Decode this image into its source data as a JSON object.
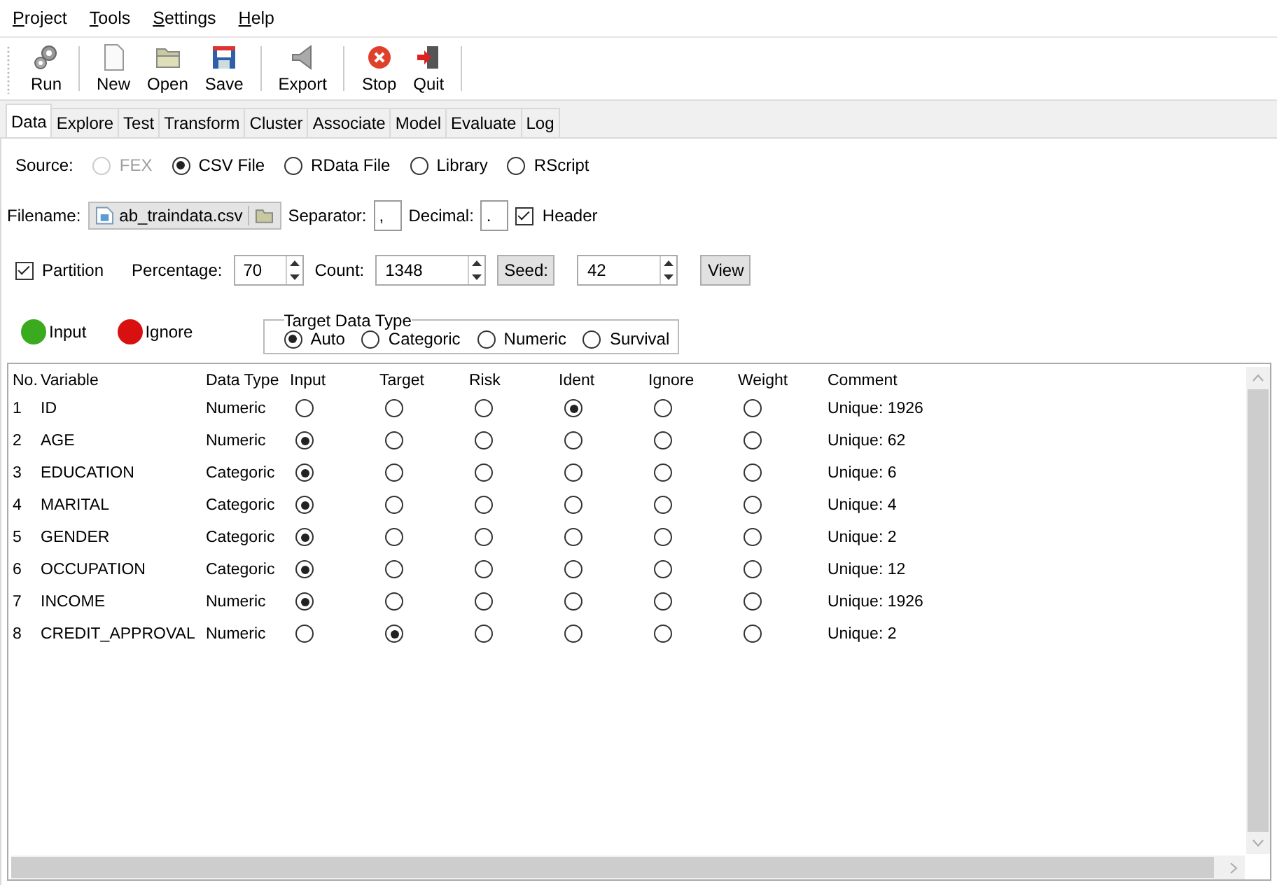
{
  "menu": [
    "Project",
    "Tools",
    "Settings",
    "Help"
  ],
  "toolbar": [
    {
      "label": "Run",
      "kind": "run"
    },
    {
      "kind": "separator"
    },
    {
      "label": "New",
      "kind": "new"
    },
    {
      "label": "Open",
      "kind": "open"
    },
    {
      "label": "Save",
      "kind": "save"
    },
    {
      "kind": "separator"
    },
    {
      "label": "Export",
      "kind": "export"
    },
    {
      "kind": "separator"
    },
    {
      "label": "Stop",
      "kind": "stop"
    },
    {
      "label": "Quit",
      "kind": "quit"
    },
    {
      "kind": "separator"
    }
  ],
  "tabs": [
    {
      "label": "Data",
      "selected": true
    },
    {
      "label": "Explore",
      "selected": false
    },
    {
      "label": "Test",
      "selected": false
    },
    {
      "label": "Transform",
      "selected": false
    },
    {
      "label": "Cluster",
      "selected": false
    },
    {
      "label": "Associate",
      "selected": false
    },
    {
      "label": "Model",
      "selected": false
    },
    {
      "label": "Evaluate",
      "selected": false
    },
    {
      "label": "Log",
      "selected": false
    }
  ],
  "source": {
    "label": "Source:",
    "options": [
      {
        "label": "FEX",
        "selected": false,
        "disabled": true
      },
      {
        "label": "CSV File",
        "selected": true,
        "disabled": false
      },
      {
        "label": "RData File",
        "selected": false,
        "disabled": false
      },
      {
        "label": "Library",
        "selected": false,
        "disabled": false
      },
      {
        "label": "RScript",
        "selected": false,
        "disabled": false
      }
    ]
  },
  "file": {
    "label": "Filename:",
    "value": "ab_traindata.csv",
    "separator_label": "Separator:",
    "separator": ",",
    "decimal_label": "Decimal:",
    "decimal": ".",
    "header": {
      "label": "Header",
      "checked": true
    }
  },
  "partition": {
    "label": "Partition",
    "checked": true,
    "percentage_label": "Percentage:",
    "percentage": "70",
    "count_label": "Count:",
    "count": "1348",
    "seed_button": "Seed:",
    "seed": "42",
    "view_button": "View"
  },
  "legend": [
    {
      "label": "Input",
      "color": "#3aaa1e"
    },
    {
      "label": "Ignore",
      "color": "#d81010"
    }
  ],
  "target_type": {
    "title": "Target Data Type",
    "options": [
      {
        "label": "Auto",
        "selected": true
      },
      {
        "label": "Categoric",
        "selected": false
      },
      {
        "label": "Numeric",
        "selected": false
      },
      {
        "label": "Survival",
        "selected": false
      }
    ]
  },
  "table": {
    "columns": [
      "No.",
      "Variable",
      "Data Type",
      "Input",
      "Target",
      "Risk",
      "Ident",
      "Ignore",
      "Weight",
      "Comment"
    ],
    "rows": [
      {
        "no": "1",
        "variable": "ID",
        "data_type": "Numeric",
        "roles": [
          {
            "selected": false
          },
          {
            "selected": false
          },
          {
            "selected": false
          },
          {
            "selected": true
          },
          {
            "selected": false
          },
          {
            "selected": false
          }
        ],
        "comment": "Unique: 1926"
      },
      {
        "no": "2",
        "variable": "AGE",
        "data_type": "Numeric",
        "roles": [
          {
            "selected": true
          },
          {
            "selected": false
          },
          {
            "selected": false
          },
          {
            "selected": false
          },
          {
            "selected": false
          },
          {
            "selected": false
          }
        ],
        "comment": "Unique: 62"
      },
      {
        "no": "3",
        "variable": "EDUCATION",
        "data_type": "Categoric",
        "roles": [
          {
            "selected": true
          },
          {
            "selected": false
          },
          {
            "selected": false
          },
          {
            "selected": false
          },
          {
            "selected": false
          },
          {
            "selected": false
          }
        ],
        "comment": "Unique: 6"
      },
      {
        "no": "4",
        "variable": "MARITAL",
        "data_type": "Categoric",
        "roles": [
          {
            "selected": true
          },
          {
            "selected": false
          },
          {
            "selected": false
          },
          {
            "selected": false
          },
          {
            "selected": false
          },
          {
            "selected": false
          }
        ],
        "comment": "Unique: 4"
      },
      {
        "no": "5",
        "variable": "GENDER",
        "data_type": "Categoric",
        "roles": [
          {
            "selected": true
          },
          {
            "selected": false
          },
          {
            "selected": false
          },
          {
            "selected": false
          },
          {
            "selected": false
          },
          {
            "selected": false
          }
        ],
        "comment": "Unique: 2"
      },
      {
        "no": "6",
        "variable": "OCCUPATION",
        "data_type": "Categoric",
        "roles": [
          {
            "selected": true
          },
          {
            "selected": false
          },
          {
            "selected": false
          },
          {
            "selected": false
          },
          {
            "selected": false
          },
          {
            "selected": false
          }
        ],
        "comment": "Unique: 12"
      },
      {
        "no": "7",
        "variable": "INCOME",
        "data_type": "Numeric",
        "roles": [
          {
            "selected": true
          },
          {
            "selected": false
          },
          {
            "selected": false
          },
          {
            "selected": false
          },
          {
            "selected": false
          },
          {
            "selected": false
          }
        ],
        "comment": "Unique: 1926"
      },
      {
        "no": "8",
        "variable": "CREDIT_APPROVAL",
        "data_type": "Numeric",
        "roles": [
          {
            "selected": false
          },
          {
            "selected": true
          },
          {
            "selected": false
          },
          {
            "selected": false
          },
          {
            "selected": false
          },
          {
            "selected": false
          }
        ],
        "comment": "Unique: 2"
      }
    ]
  }
}
